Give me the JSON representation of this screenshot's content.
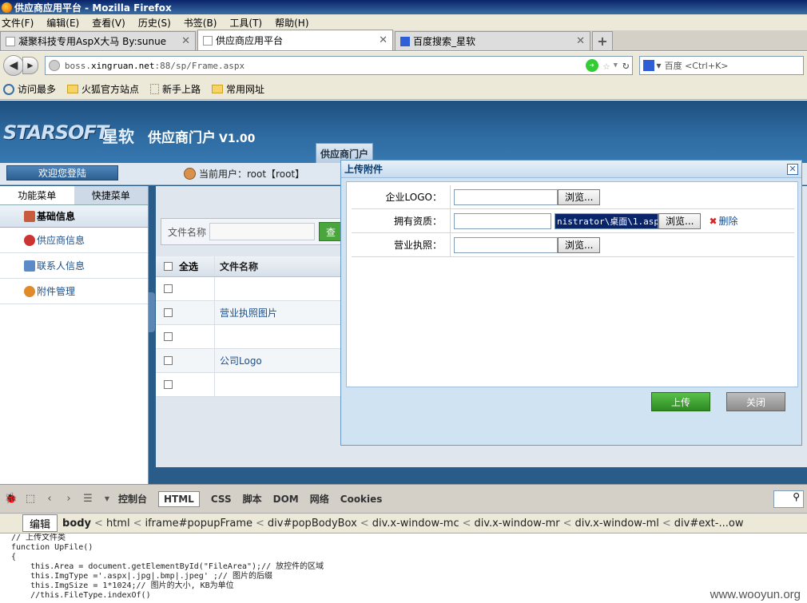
{
  "window": {
    "title": "供应商应用平台 - Mozilla Firefox"
  },
  "menubar": [
    "文件(F)",
    "编辑(E)",
    "查看(V)",
    "历史(S)",
    "书签(B)",
    "工具(T)",
    "帮助(H)"
  ],
  "tabs": [
    {
      "label": "凝聚科技专用AspX大马 By:sunue",
      "active": false
    },
    {
      "label": "供应商应用平台",
      "active": true
    },
    {
      "label": "百度搜索_星软",
      "active": false
    }
  ],
  "navbar": {
    "url_prefix": "boss.",
    "url_host": "xingruan.net",
    "url_rest": ":88/sp/Frame.aspx",
    "search_placeholder": "百度 <Ctrl+K>"
  },
  "bookmarks": [
    "访问最多",
    "火狐官方站点",
    "新手上路",
    "常用网址"
  ],
  "app": {
    "logo": "STARSOFT",
    "logo_cn": "星软",
    "title": "供应商门户",
    "version": "V1.00",
    "portal_tab": "供应商门户",
    "welcome": "欢迎您登陆",
    "current_user": "当前用户：root【root】"
  },
  "leftpanel": {
    "tabs": [
      "功能菜单",
      "快捷菜单"
    ],
    "section": "基础信息",
    "items": [
      "供应商信息",
      "联系人信息",
      "附件管理"
    ]
  },
  "mainpanel": {
    "search_label": "文件名称",
    "query_button": "查",
    "table_header": {
      "select_all": "全选",
      "filename": "文件名称"
    },
    "rows": [
      "",
      "营业执照图片",
      "",
      "公司Logo",
      ""
    ]
  },
  "modal": {
    "title": "上传附件",
    "rows": [
      {
        "label": "企业LOGO：",
        "browse": "浏览..."
      },
      {
        "label": "拥有资质：",
        "file_value": "nistrator\\桌面\\1.aspx",
        "browse": "浏览...",
        "delete": "删除"
      },
      {
        "label": "营业执照：",
        "browse": "浏览..."
      }
    ],
    "upload_button": "上传",
    "close_button": "关闭"
  },
  "firebug": {
    "tabs": [
      "控制台",
      "HTML",
      "CSS",
      "脚本",
      "DOM",
      "网络",
      "Cookies"
    ],
    "edit_button": "编辑",
    "breadcrumbs": [
      "body",
      "html",
      "iframe#popupFrame",
      "div#popBodyBox",
      "div.x-window-mc",
      "div.x-window-mr",
      "div.x-window-ml",
      "div#ext-...ow"
    ],
    "code": [
      "// 上传文件类",
      "function UpFile()",
      "{",
      "    this.Area = document.getElementById(\"FileArea\");// 放控件的区域",
      "    this.ImgType ='.aspx|.jpg|.bmp|.jpeg' ;// 图片的后缀",
      "    this.ImgSize = 1*1024;// 图片的大小, KB为单位",
      "    //this.FileType.indexOf()"
    ]
  },
  "watermark": "www.wooyun.org"
}
